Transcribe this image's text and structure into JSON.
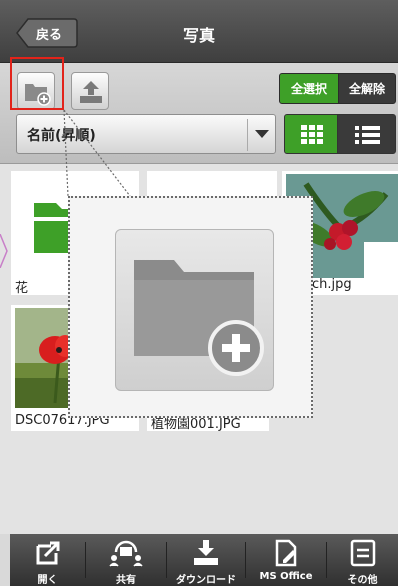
{
  "navbar": {
    "back_label": "戻る",
    "title": "写真"
  },
  "toolbar": {
    "select_all": "全選択",
    "deselect_all": "全解除",
    "sort_label": "名前(昇順)",
    "accent": "#3ea028"
  },
  "files": [
    {
      "name": "花",
      "type": "folder"
    },
    {
      "name": "",
      "type": "image"
    },
    {
      "name": "ch.jpg",
      "type": "image"
    },
    {
      "name": "DSC07617.JPG",
      "type": "image"
    },
    {
      "name": "植物園001.JPG",
      "type": "image"
    }
  ],
  "callout": {
    "icon": "new-folder-icon"
  },
  "bottombar": {
    "items": [
      {
        "label": "開く",
        "icon": "open-icon"
      },
      {
        "label": "共有",
        "icon": "share-icon"
      },
      {
        "label": "ダウンロード",
        "icon": "download-icon"
      },
      {
        "label": "MS Office",
        "icon": "ms-office-icon"
      },
      {
        "label": "その他",
        "icon": "more-icon"
      }
    ]
  }
}
